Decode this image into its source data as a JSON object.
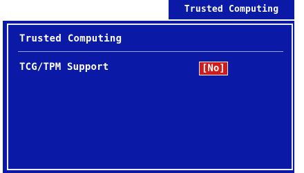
{
  "window": {
    "header_title": "Trusted Computing"
  },
  "section": {
    "title": "Trusted Computing"
  },
  "settings": [
    {
      "label": "TCG/TPM Support",
      "value": "[No]"
    }
  ],
  "colors": {
    "panel_blue": "#0a1aa6",
    "text_white": "#ffffff",
    "selection_red": "#d11a1a"
  }
}
